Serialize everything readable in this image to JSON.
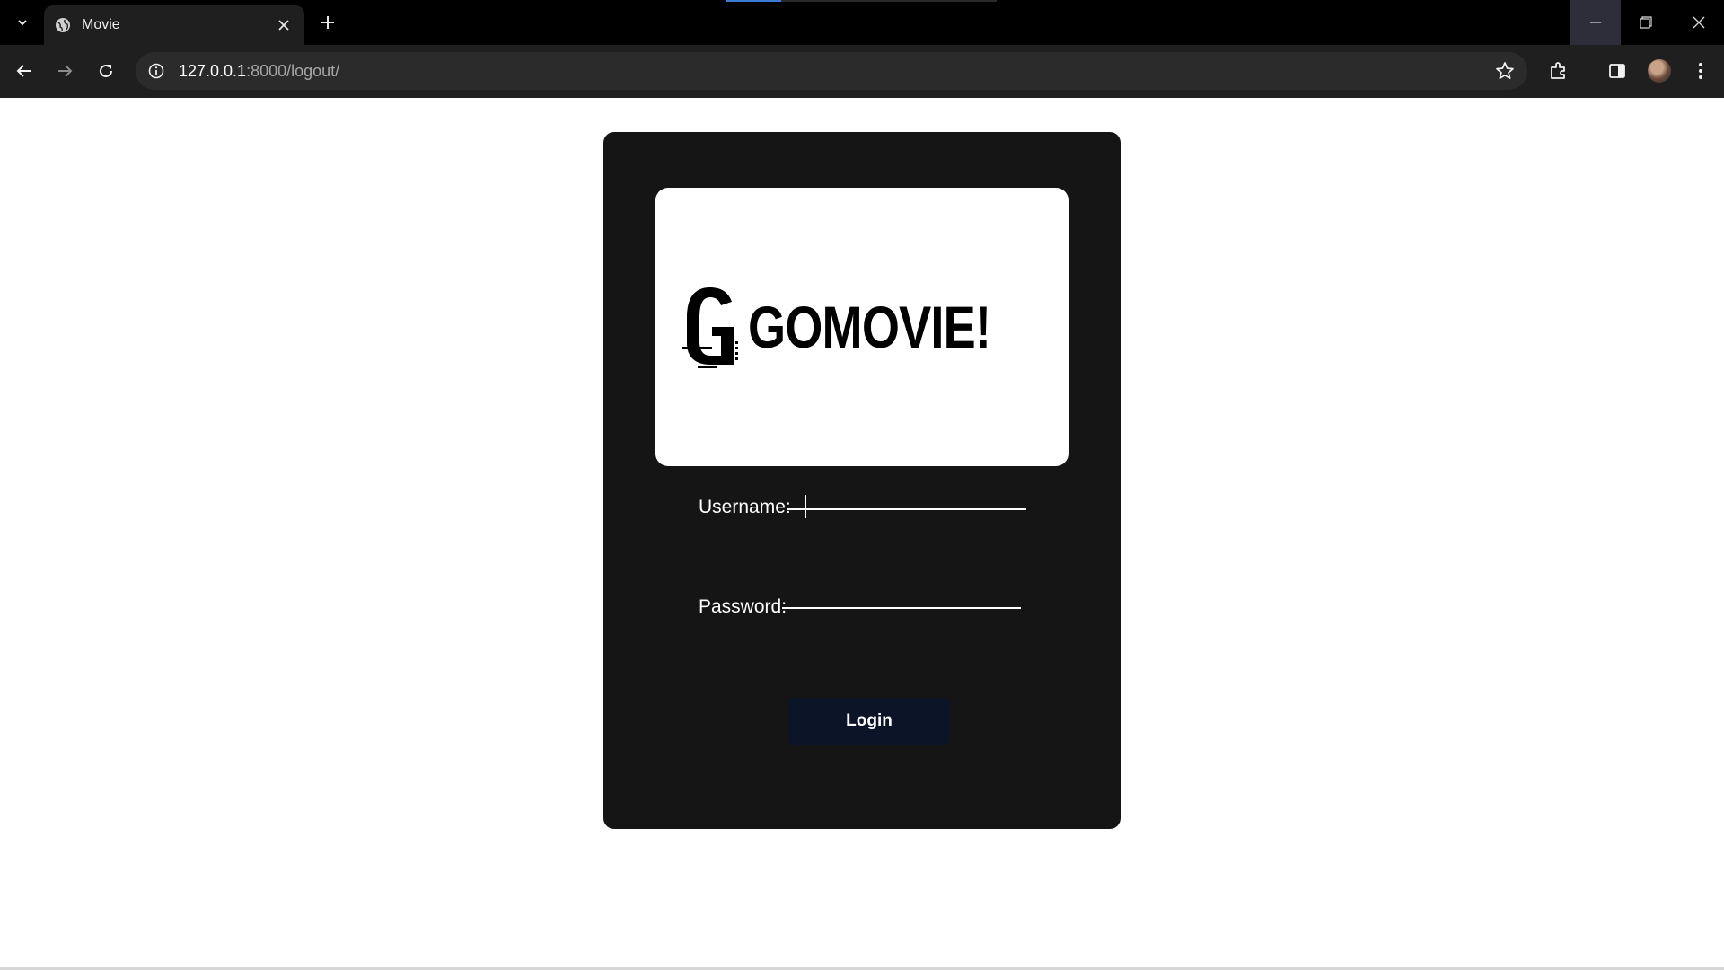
{
  "browser": {
    "tab_title": "Movie",
    "url_host": "127.0.0.1",
    "url_rest": ":8000/logout/"
  },
  "login_form": {
    "brand": "GOMOVIE!",
    "username_label": "Username:",
    "username_value": "",
    "password_label": "Password:",
    "password_value": "",
    "login_label": "Login"
  }
}
